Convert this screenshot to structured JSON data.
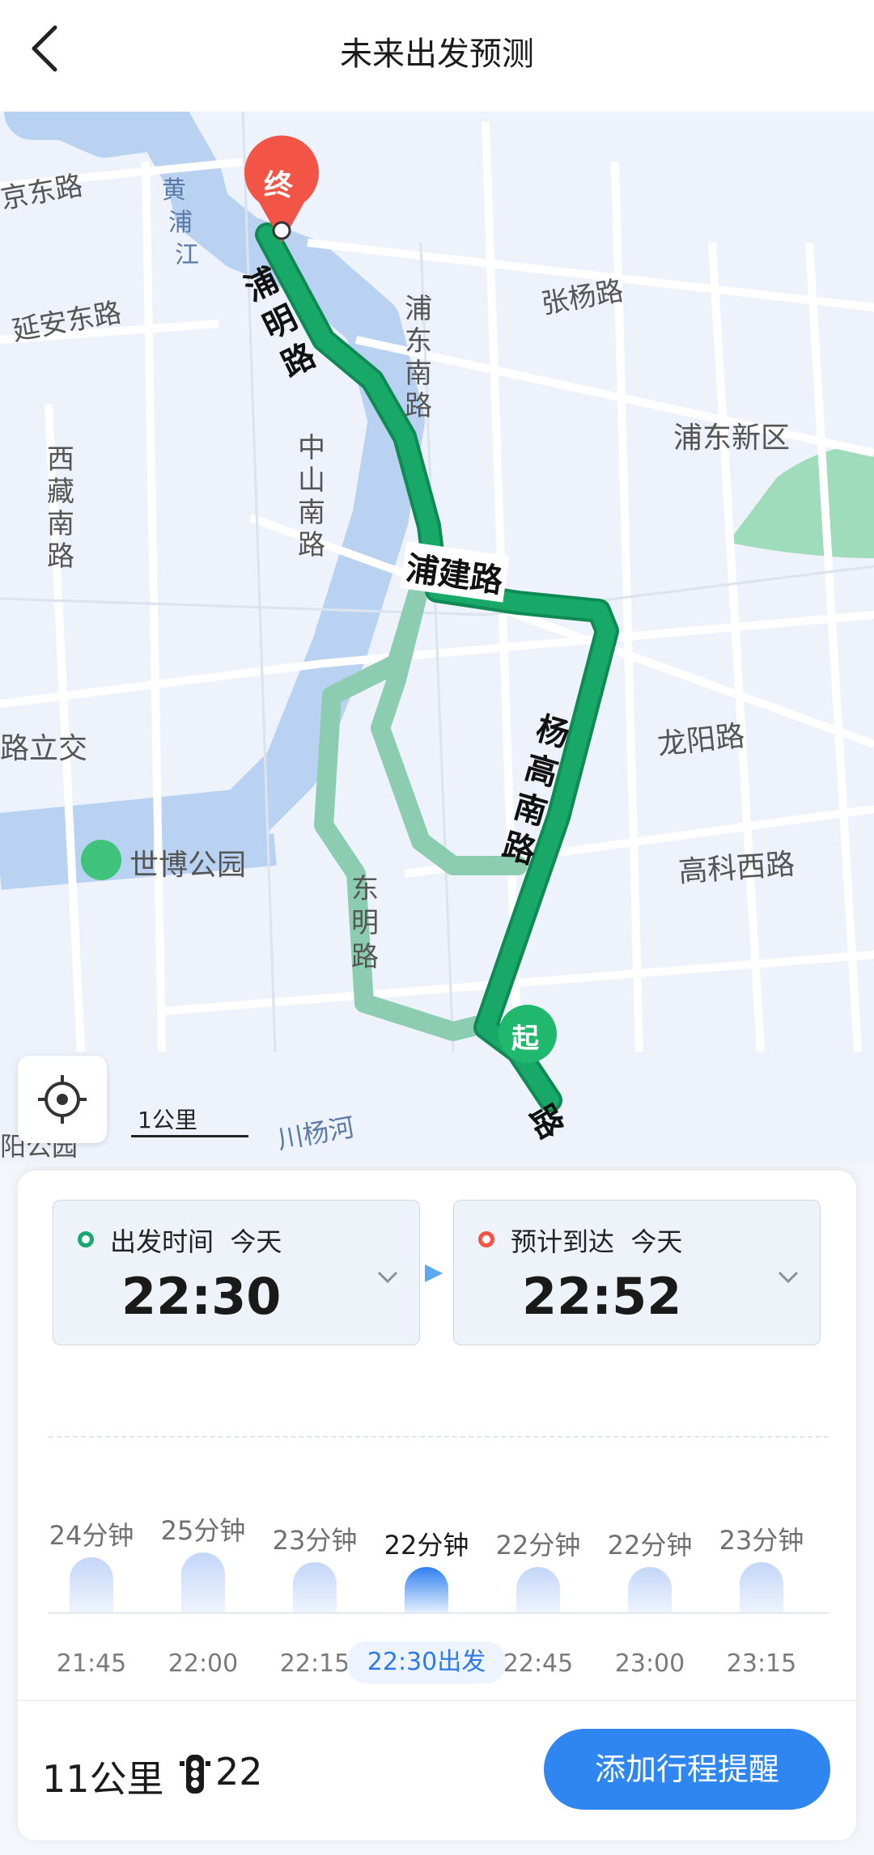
{
  "header": {
    "title": "未来出发预测"
  },
  "map": {
    "labels": {
      "road1": "京东路",
      "river1": "黄",
      "river2": "浦",
      "river3": "江",
      "road2": "延安东路",
      "road3": "张杨路",
      "road4": "浦东南路",
      "road5": "西藏南路",
      "road6": "中山南路",
      "district": "浦东新区",
      "road7": "浦建路",
      "road8": "浦明路",
      "road9": "杨高南路",
      "road10": "龙阳路",
      "road11": "路立交",
      "park": "世博公园",
      "road12": "高科西路",
      "road13": "东明路",
      "road14": "川杨河",
      "road15": "阳公园",
      "road16": "路"
    },
    "start_marker": "起",
    "end_marker": "终",
    "scale_label": "1公里",
    "colors": {
      "route": "#18a868",
      "route_alt": "#8ccdb2",
      "water": "#b9d2f1",
      "start": "#1fb86d",
      "end": "#f25545"
    }
  },
  "depart": {
    "label": "出发时间",
    "day": "今天",
    "time": "22:30"
  },
  "arrive": {
    "label": "预计到达",
    "day": "今天",
    "time": "22:52"
  },
  "forecast": [
    {
      "duration": "24分钟",
      "time": "21:45",
      "minutes": 24
    },
    {
      "duration": "25分钟",
      "time": "22:00",
      "minutes": 25
    },
    {
      "duration": "23分钟",
      "time": "22:15",
      "minutes": 23
    },
    {
      "duration": "22分钟",
      "time": "22:30出发",
      "minutes": 22
    },
    {
      "duration": "22分钟",
      "time": "22:45",
      "minutes": 22
    },
    {
      "duration": "22分钟",
      "time": "23:00",
      "minutes": 22
    },
    {
      "duration": "23分钟",
      "time": "23:15",
      "minutes": 23
    }
  ],
  "summary": {
    "distance": "11公里",
    "traffic_lights": "22",
    "traffic_icon": "traffic-light-icon"
  },
  "action": {
    "reminder_label": "添加行程提醒"
  }
}
